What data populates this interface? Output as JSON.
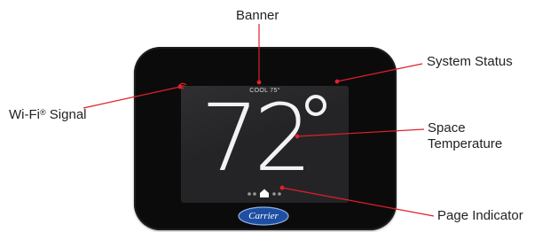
{
  "device": {
    "banner_text": "COOL 75°",
    "temperature": "72",
    "brand": "Carrier"
  },
  "callouts": {
    "banner": "Banner",
    "system_status": "System Status",
    "wifi_signal_prefix": "Wi-Fi",
    "wifi_signal_mark": "®",
    "wifi_signal_suffix": " Signal",
    "space_temperature_line1": "Space",
    "space_temperature_line2": "Temperature",
    "page_indicator": "Page Indicator"
  },
  "colors": {
    "leader_line": "#e0202a",
    "device_body": "#0b0b0c",
    "screen": "#242426",
    "brand_logo": "#1f4fa3"
  },
  "icons": [
    "wifi-icon",
    "home-icon",
    "carrier-logo"
  ]
}
